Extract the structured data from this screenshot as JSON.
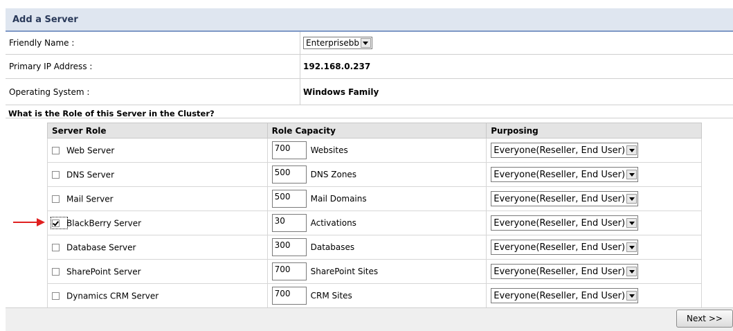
{
  "header": {
    "title": "Add a Server"
  },
  "info": [
    {
      "label": "Friendly Name :",
      "value": "Enterprisebb",
      "type": "select"
    },
    {
      "label": "Primary IP Address :",
      "value": "192.168.0.237",
      "type": "text"
    },
    {
      "label": "Operating System :",
      "value": "Windows Family",
      "type": "text"
    }
  ],
  "question": "What is the Role of this Server in the Cluster?",
  "table": {
    "headers": [
      "Server Role",
      "Role Capacity",
      "Purposing"
    ],
    "rows": [
      {
        "role": "Web Server",
        "checked": false,
        "capacity": "700",
        "unit": "Websites",
        "purposing": "Everyone(Reseller, End User)"
      },
      {
        "role": "DNS Server",
        "checked": false,
        "capacity": "500",
        "unit": "DNS Zones",
        "purposing": "Everyone(Reseller, End User)"
      },
      {
        "role": "Mail Server",
        "checked": false,
        "capacity": "500",
        "unit": "Mail Domains",
        "purposing": "Everyone(Reseller, End User)"
      },
      {
        "role": "BlackBerry Server",
        "checked": true,
        "capacity": "30",
        "unit": "Activations",
        "purposing": "Everyone(Reseller, End User)"
      },
      {
        "role": "Database Server",
        "checked": false,
        "capacity": "300",
        "unit": "Databases",
        "purposing": "Everyone(Reseller, End User)"
      },
      {
        "role": "SharePoint Server",
        "checked": false,
        "capacity": "700",
        "unit": "SharePoint Sites",
        "purposing": "Everyone(Reseller, End User)"
      },
      {
        "role": "Dynamics CRM Server",
        "checked": false,
        "capacity": "700",
        "unit": "CRM Sites",
        "purposing": "Everyone(Reseller, End User)"
      }
    ]
  },
  "footer": {
    "next_label": "Next >>"
  },
  "colors": {
    "header_bg": "#dfe6f0",
    "header_border": "#7d97c6",
    "annotation_arrow": "#e02020"
  }
}
